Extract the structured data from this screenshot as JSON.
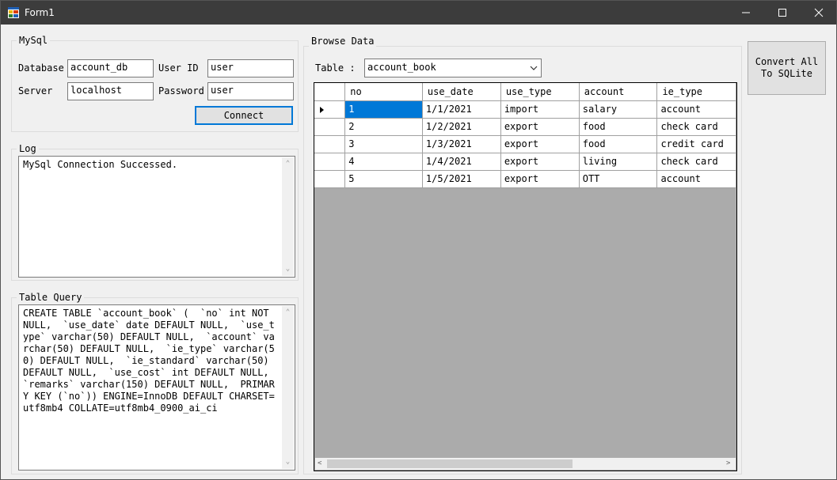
{
  "window": {
    "title": "Form1"
  },
  "mysql": {
    "group_title": "MySql",
    "database_label": "Database",
    "database_value": "account_db",
    "userid_label": "User ID",
    "userid_value": "user",
    "server_label": "Server",
    "server_value": "localhost",
    "password_label": "Password",
    "password_value": "user",
    "connect_label": "Connect"
  },
  "log": {
    "group_title": "Log",
    "text": "MySql Connection Successed."
  },
  "query": {
    "group_title": "Table Query",
    "text": "CREATE TABLE `account_book` (  `no` int NOT NULL,  `use_date` date DEFAULT NULL,  `use_type` varchar(50) DEFAULT NULL,  `account` varchar(50) DEFAULT NULL,  `ie_type` varchar(50) DEFAULT NULL,  `ie_standard` varchar(50) DEFAULT NULL,  `use_cost` int DEFAULT NULL,  `remarks` varchar(150) DEFAULT NULL,  PRIMARY KEY (`no`)) ENGINE=InnoDB DEFAULT CHARSET=utf8mb4 COLLATE=utf8mb4_0900_ai_ci"
  },
  "browse": {
    "group_title": "Browse Data",
    "table_label": "Table :",
    "table_selected": "account_book",
    "columns": [
      "no",
      "use_date",
      "use_type",
      "account",
      "ie_type"
    ],
    "rows": [
      [
        "1",
        "1/1/2021",
        "import",
        "salary",
        "account"
      ],
      [
        "2",
        "1/2/2021",
        "export",
        "food",
        "check card"
      ],
      [
        "3",
        "1/3/2021",
        "export",
        "food",
        "credit card"
      ],
      [
        "4",
        "1/4/2021",
        "export",
        "living",
        "check card"
      ],
      [
        "5",
        "1/5/2021",
        "export",
        "OTT",
        "account"
      ]
    ],
    "selected_row": 0
  },
  "convert": {
    "label_line1": "Convert All",
    "label_line2": "To SQLite"
  },
  "colors": {
    "titlebar": "#3c3c3c",
    "selection": "#0078d7",
    "focus_border": "#0078d7",
    "grid_empty": "#ababab"
  }
}
